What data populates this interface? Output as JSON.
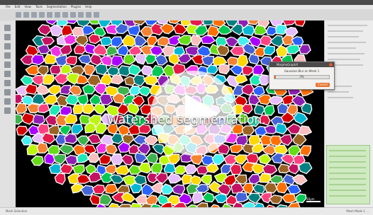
{
  "menu": {
    "items": [
      "File",
      "Edit",
      "View",
      "Tools",
      "Segmentation",
      "Plugins",
      "Help"
    ]
  },
  "dialog": {
    "title": "MorphoGraphX",
    "message": "Gaussian Blur on Mesh 1",
    "progress_label": "3%",
    "progress": 0.03,
    "cancel_label": "Cancel"
  },
  "caption": "Watershed segmentation.",
  "scale_label": "30µm",
  "status": {
    "left": "Mesh Selection",
    "right": "Mesh Mode 1 ..."
  },
  "colors": {
    "accent": "#e8742f",
    "panel_green": "#cfe9c0",
    "titlebar": "#4a4a4a"
  },
  "icons": {
    "play": "play-icon",
    "close": "close-icon"
  }
}
